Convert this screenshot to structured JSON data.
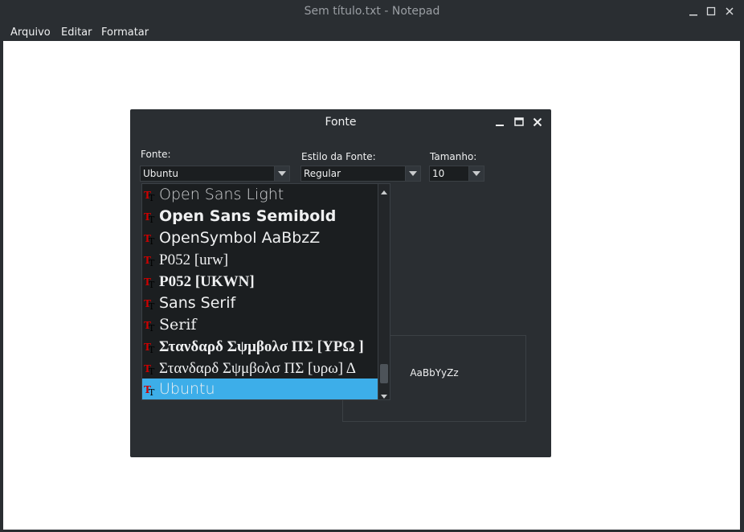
{
  "window": {
    "title": "Sem título.txt - Notepad"
  },
  "menu": {
    "items": [
      "Arquivo",
      "Editar",
      "Formatar"
    ]
  },
  "dialog": {
    "title": "Fonte",
    "font_label": "Fonte:",
    "font_value": "Ubuntu",
    "style_label": "Estilo da Fonte:",
    "style_value": "Regular",
    "size_label": "Tamanho:",
    "size_value": "10",
    "font_list": [
      "Open Sans Light",
      "Open Sans Semibold",
      "OpenSymbol  AaBbzZ",
      "P052 [urw]",
      "P052 [UKWN]",
      "Sans Serif",
      "Serif",
      "Στανδαρδ Σψμβολσ ΠΣ [ΥΡΩ ]",
      "Στανδαρδ Σψμβολσ ΠΣ [υρω]  Δ",
      "Ubuntu"
    ],
    "preview_text": "AaBbYyZz"
  },
  "colors": {
    "selection": "#3daee9",
    "dialog_bg": "#2a2e32",
    "list_bg": "#1b1e20",
    "icon_red": "#cc0000"
  }
}
